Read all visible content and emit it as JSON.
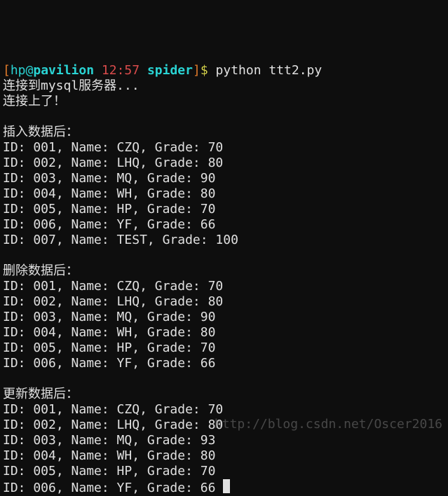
{
  "prompt": {
    "lb": "[",
    "user": "hp",
    "at": "@",
    "host": "pavilion",
    "time": "12:57",
    "dir": "spider",
    "rb": "]",
    "dollar": "$ ",
    "command": "python ttt2.py"
  },
  "conn1": "连接到mysql服务器...",
  "conn2": "连接上了！",
  "blank": "",
  "section_insert": "插入数据后：",
  "after_insert": [
    "ID: 001, Name: CZQ, Grade: 70",
    "ID: 002, Name: LHQ, Grade: 80",
    "ID: 003, Name: MQ, Grade: 90",
    "ID: 004, Name: WH, Grade: 80",
    "ID: 005, Name: HP, Grade: 70",
    "ID: 006, Name: YF, Grade: 66",
    "ID: 007, Name: TEST, Grade: 100"
  ],
  "section_delete": "删除数据后：",
  "after_delete": [
    "ID: 001, Name: CZQ, Grade: 70",
    "ID: 002, Name: LHQ, Grade: 80",
    "ID: 003, Name: MQ, Grade: 90",
    "ID: 004, Name: WH, Grade: 80",
    "ID: 005, Name: HP, Grade: 70",
    "ID: 006, Name: YF, Grade: 66"
  ],
  "section_update": "更新数据后：",
  "after_update": [
    "ID: 001, Name: CZQ, Grade: 70",
    "ID: 002, Name: LHQ, Grade: 80",
    "ID: 003, Name: MQ, Grade: 93",
    "ID: 004, Name: WH, Grade: 80",
    "ID: 005, Name: HP, Grade: 70",
    "ID: 006, Name: YF, Grade: 66"
  ],
  "watermark": "http://blog.csdn.net/Oscer2016"
}
